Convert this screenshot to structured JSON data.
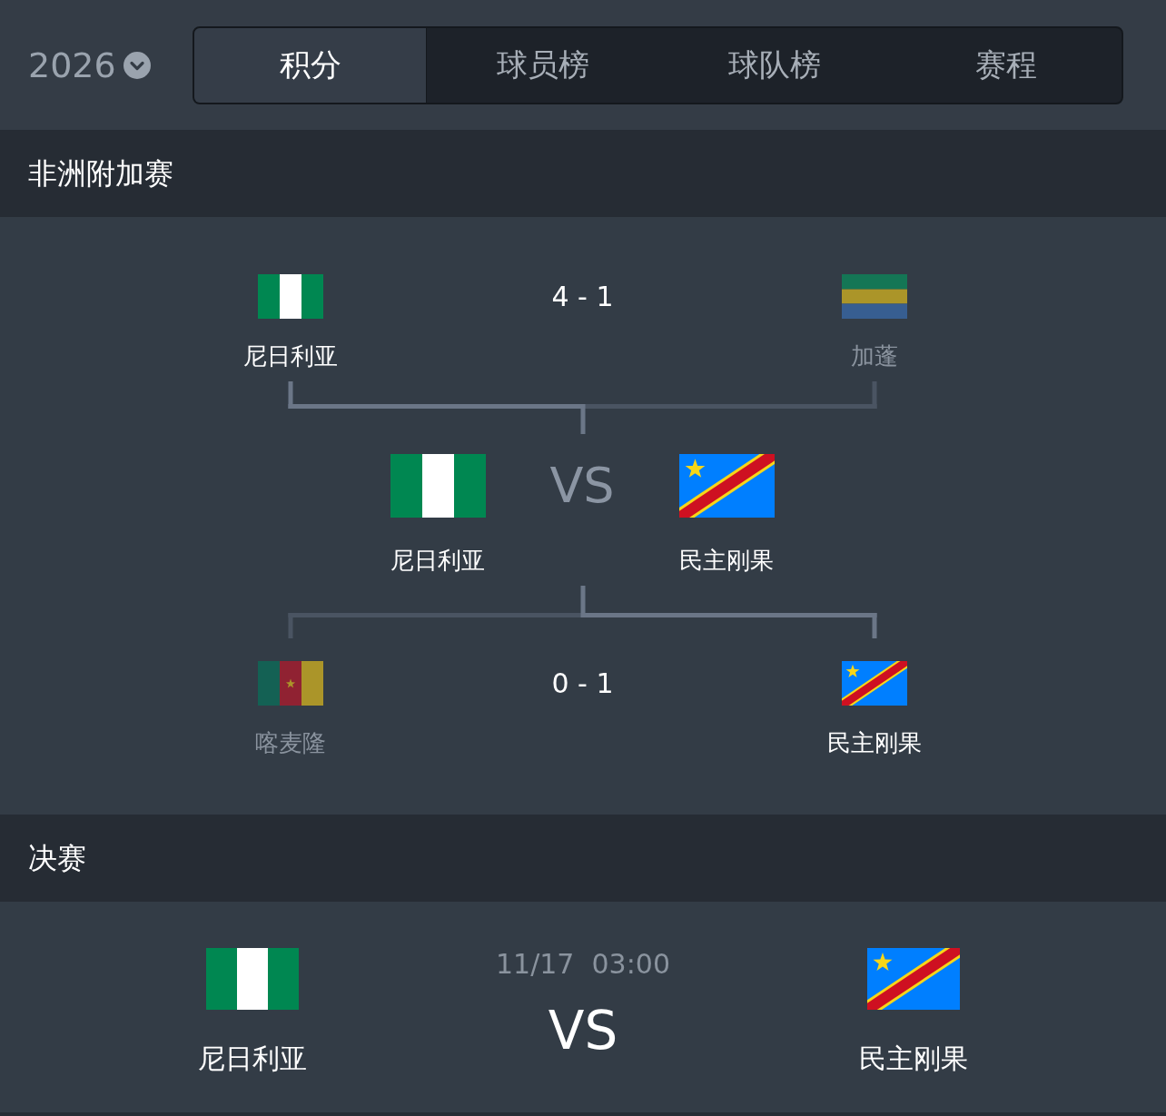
{
  "header": {
    "season": "2026",
    "tabs": [
      {
        "label": "积分",
        "selected": true
      },
      {
        "label": "球员榜",
        "selected": false
      },
      {
        "label": "球队榜",
        "selected": false
      },
      {
        "label": "赛程",
        "selected": false
      }
    ]
  },
  "sections": [
    {
      "kind": "bracket",
      "title": "非洲附加赛",
      "semifinals": [
        {
          "teams": [
            {
              "name": "尼日利亚",
              "kind": "nigeria",
              "eliminated": false
            },
            {
              "name": "加蓬",
              "kind": "gabon",
              "eliminated": true
            }
          ],
          "score": "4 - 1"
        },
        {
          "teams": [
            {
              "name": "喀麦隆",
              "kind": "cameroon",
              "eliminated": true
            },
            {
              "name": "民主刚果",
              "kind": "drc",
              "eliminated": false
            }
          ],
          "score": "0 - 1"
        }
      ],
      "final": {
        "teams": [
          {
            "name": "尼日利亚",
            "kind": "nigeria",
            "eliminated": false
          },
          {
            "name": "民主刚果",
            "kind": "drc",
            "eliminated": false
          }
        ],
        "center": "VS"
      }
    },
    {
      "kind": "match",
      "title": "决赛",
      "match": {
        "teams": [
          {
            "name": "尼日利亚",
            "kind": "nigeria",
            "eliminated": false
          },
          {
            "name": "民主刚果",
            "kind": "drc",
            "eliminated": false
          }
        ],
        "time": "11/17  03:00",
        "center": "VS"
      }
    }
  ]
}
